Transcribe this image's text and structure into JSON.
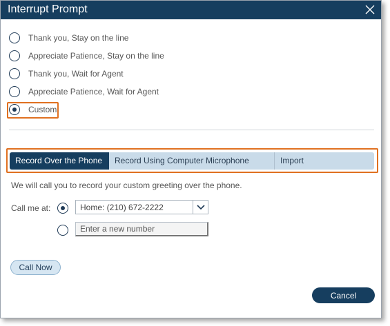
{
  "dialog": {
    "title": "Interrupt Prompt",
    "close_icon": "close-icon"
  },
  "prompt_options": [
    {
      "label": "Thank you, Stay on the line",
      "checked": false
    },
    {
      "label": "Appreciate Patience, Stay on the line",
      "checked": false
    },
    {
      "label": "Thank you, Wait for Agent",
      "checked": false
    },
    {
      "label": "Appreciate Patience, Wait for Agent",
      "checked": false
    },
    {
      "label": "Custom",
      "checked": true
    }
  ],
  "tabs": [
    {
      "label": "Record Over the Phone",
      "active": true
    },
    {
      "label": "Record Using Computer Microphone",
      "active": false
    },
    {
      "label": "Import",
      "active": false
    }
  ],
  "phone": {
    "description": "We will call you to record your custom greeting over the phone.",
    "call_me_label": "Call me at:",
    "selected_number": "Home: (210) 672-2222",
    "new_number_placeholder": "Enter a new number",
    "call_now_label": "Call Now"
  },
  "footer": {
    "cancel_label": "Cancel"
  },
  "colors": {
    "header": "#163e5f",
    "highlight": "#e07020",
    "tab_bar": "#c9dbe9"
  }
}
